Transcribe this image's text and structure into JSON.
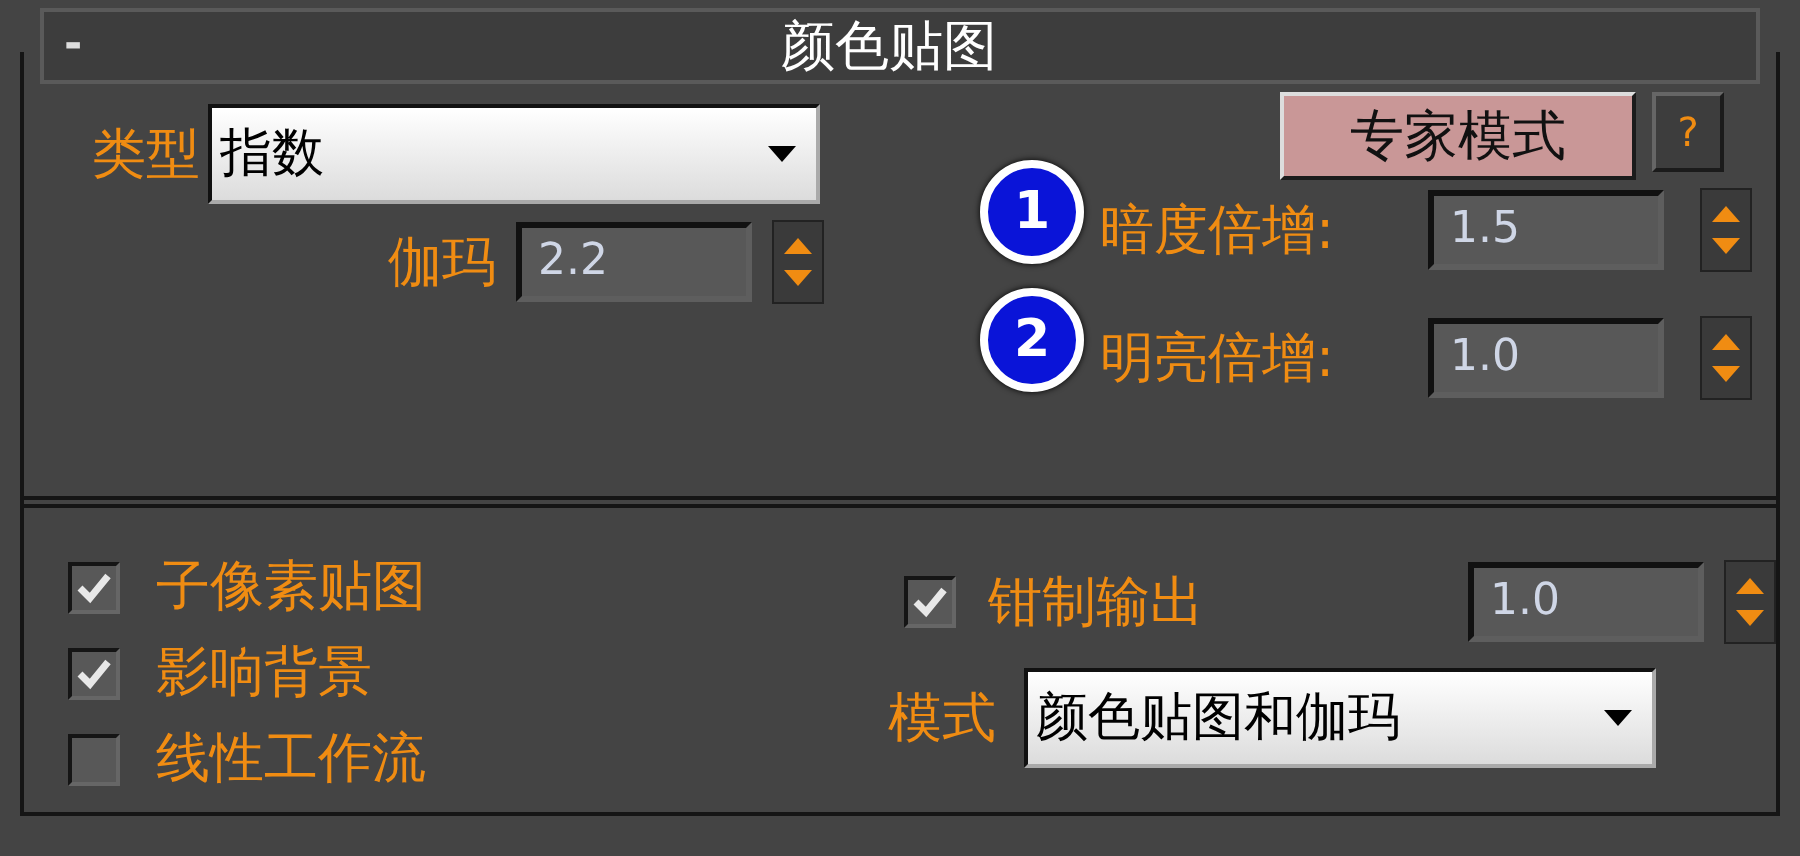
{
  "rollout": {
    "collapse_sign": "-",
    "title": "颜色贴图"
  },
  "type": {
    "label": "类型",
    "value": "指数"
  },
  "gamma": {
    "label": "伽玛",
    "value": "2.2"
  },
  "expert_button": "专家模式",
  "help_button": "?",
  "multipliers": [
    {
      "marker": "1",
      "label": "暗度倍增:",
      "value": "1.5"
    },
    {
      "marker": "2",
      "label": "明亮倍增:",
      "value": "1.0"
    }
  ],
  "options": [
    {
      "label": "子像素贴图",
      "checked": true
    },
    {
      "label": "影响背景",
      "checked": true
    },
    {
      "label": "线性工作流",
      "checked": false
    }
  ],
  "clamp": {
    "label": "钳制输出",
    "checked": true,
    "value": "1.0"
  },
  "mode": {
    "label": "模式",
    "value": "颜色贴图和伽玛"
  }
}
